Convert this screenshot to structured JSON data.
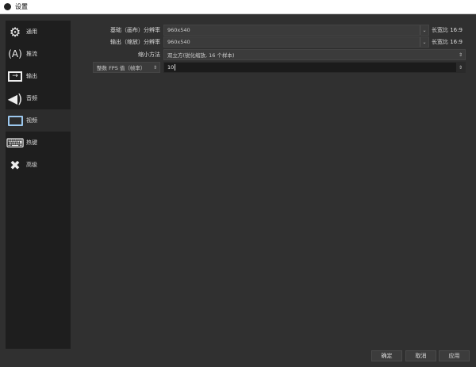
{
  "window": {
    "title": "设置"
  },
  "sidebar": {
    "items": [
      {
        "label": "通用",
        "icon": "gear-icon",
        "glyph": "⚙"
      },
      {
        "label": "推流",
        "icon": "antenna-icon",
        "glyph": "📡"
      },
      {
        "label": "输出",
        "icon": "output-icon",
        "glyph": "⇥"
      },
      {
        "label": "音频",
        "icon": "speaker-icon",
        "glyph": "🔊"
      },
      {
        "label": "视频",
        "icon": "monitor-icon",
        "glyph": "🖵",
        "selected": true
      },
      {
        "label": "热键",
        "icon": "keyboard-icon",
        "glyph": "⌨"
      },
      {
        "label": "高级",
        "icon": "tools-icon",
        "glyph": "✖"
      }
    ]
  },
  "video": {
    "base_label": "基础（画布）分辨率",
    "base_value": "960x540",
    "base_aspect": "长宽比 16:9",
    "output_label": "输出（缩放）分辨率",
    "output_value": "960x540",
    "output_aspect": "长宽比 16:9",
    "filter_label": "缩小方法",
    "filter_value": "双立方(锐化缩放, 16 个样本)",
    "fps_type": "整数 FPS 值（帧率）",
    "fps_value": "10"
  },
  "buttons": {
    "ok": "确定",
    "cancel": "取消",
    "apply": "应用"
  }
}
